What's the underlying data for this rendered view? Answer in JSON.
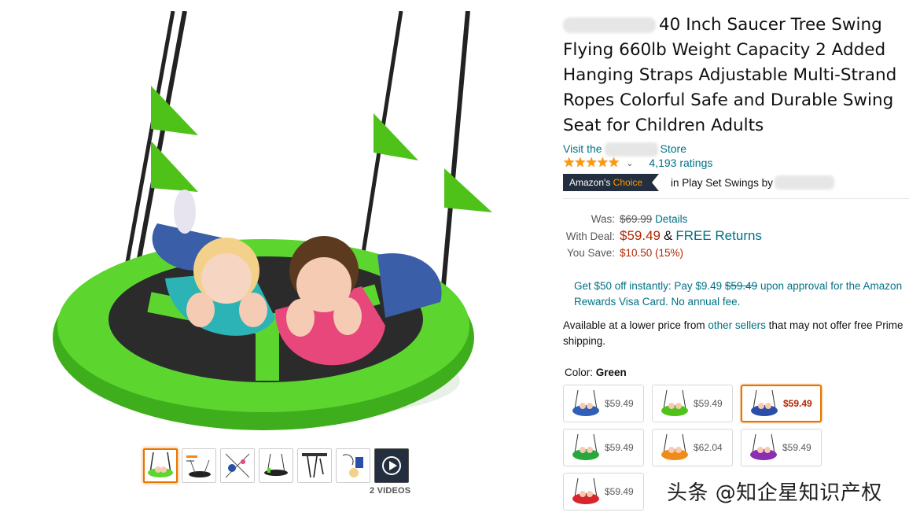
{
  "product": {
    "title": "40 Inch Saucer Tree Swing Flying 660lb Weight Capacity 2 Added Hanging Straps Adjustable Multi-Strand Ropes Colorful Safe and Durable Swing Seat for Children Adults",
    "store_prefix": "Visit the",
    "store_suffix": "Store",
    "stars": "★★★★★",
    "rating_value": 4.7,
    "ratings_count": "4,193 ratings",
    "badge_prefix": "Amazon's",
    "badge_accent": "Choice",
    "badge_context": "in Play Set Swings by"
  },
  "pricing": {
    "was_label": "Was:",
    "was_price": "$69.99",
    "details_link": "Details",
    "deal_label": "With Deal:",
    "deal_price": "$59.49",
    "amp": "&",
    "free_returns": "FREE Returns",
    "save_label": "You Save:",
    "save_amount": "$10.50 (15%)"
  },
  "offer": {
    "text_a": "Get $50 off instantly: Pay $9.49",
    "strike_price": "$59.49",
    "text_b": "upon approval for the Amazon Rewards Visa Card. No annual fee."
  },
  "availability": {
    "text_a": "Available at a lower price from",
    "link": "other sellers",
    "text_b": "that may not offer free Prime shipping."
  },
  "color": {
    "label": "Color:",
    "selected": "Green",
    "options": [
      {
        "price": "$59.49",
        "seat": "#2f5fb8"
      },
      {
        "price": "$59.49",
        "seat": "#4fc21a"
      },
      {
        "price": "$59.49",
        "seat": "#2a4fa8",
        "selected": true
      },
      {
        "price": "$59.49",
        "seat": "#27a83c"
      },
      {
        "price": "$62.04",
        "seat": "#f08a18"
      },
      {
        "price": "$59.49",
        "seat": "#8a2fb3"
      },
      {
        "price": "$59.49",
        "seat": "#d8262c"
      }
    ]
  },
  "gallery": {
    "thumbnail_count": 7,
    "videos_label": "2 VIDEOS"
  },
  "watermark": "头条 @知企星知识产权",
  "colors": {
    "link": "#007185",
    "price": "#b12704",
    "star": "#ff9900",
    "badge_bg": "#232f3e",
    "selected_border": "#e77600",
    "swing_green": "#5cd62e"
  }
}
